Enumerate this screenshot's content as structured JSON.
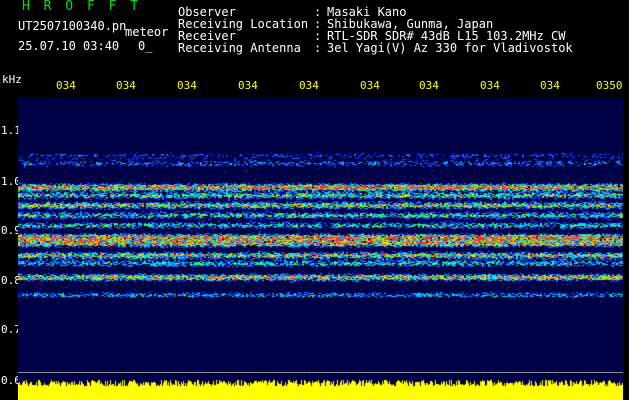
{
  "header": {
    "app_name": "H R O F F T",
    "file_name": "UT2507100340.pn",
    "meteor_label": "meteor",
    "datetime": "25.07.10 03:40",
    "counter": "0_",
    "info": [
      {
        "label": "Observer",
        "value": "Masaki Kano"
      },
      {
        "label": "Receiving Location",
        "value": "Shibukawa, Gunma, Japan"
      },
      {
        "label": "Receiver",
        "value": "RTL-SDR SDR# 43dB L15 103.2MHz CW"
      },
      {
        "label": "Receiving Antenna",
        "value": "3el Yagi(V) Az 330 for Vladivostok"
      }
    ]
  },
  "axes": {
    "y_unit": "kHz",
    "y_ticks": [
      "1.1",
      "1.0",
      "0.9",
      "0.8",
      "0.7",
      "0.6"
    ],
    "x_ticks": [
      "034",
      "034",
      "034",
      "034",
      "034",
      "034",
      "034",
      "034",
      "034",
      "0350"
    ]
  },
  "colors": {
    "title": "#00e000",
    "text": "#ffffff",
    "time_ticks": "#ffff00",
    "freq_ticks": "#ffffff",
    "background": "#000000",
    "spectrogram_bg": "#000045",
    "noise_trace": "#ffff00"
  }
}
